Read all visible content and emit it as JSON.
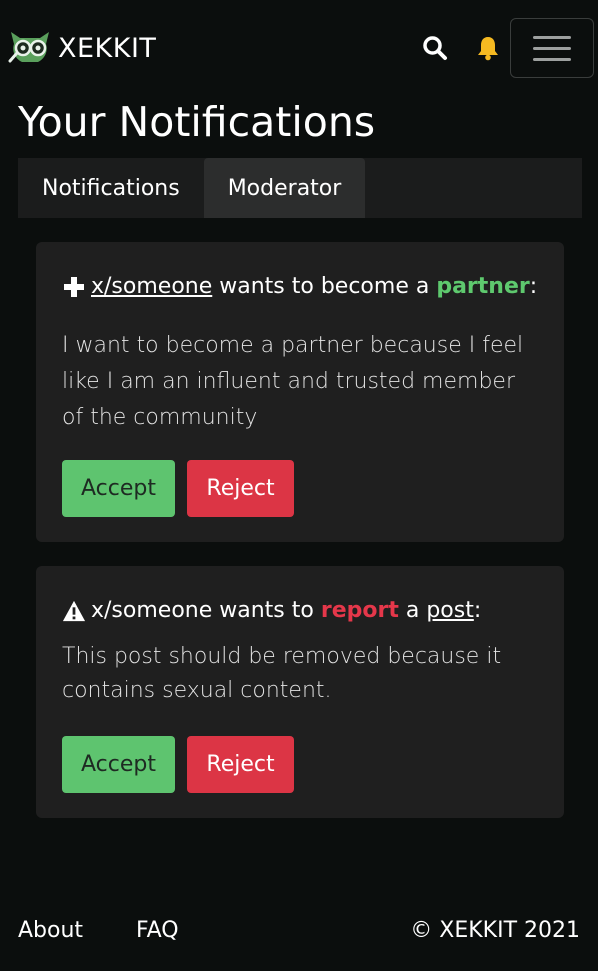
{
  "brand": {
    "name": "XEKKIT"
  },
  "page": {
    "title": "Your Notifications"
  },
  "tabs": [
    {
      "label": "Notifications",
      "active": false
    },
    {
      "label": "Moderator",
      "active": true
    }
  ],
  "requests": [
    {
      "icon": "plus-icon",
      "user": "x/someone",
      "text_middle": " wants to become a ",
      "keyword": "partner",
      "text_end": ":",
      "message": "I want to become a partner because I feel like I am an influent and trusted member of the community",
      "accept_label": "Accept",
      "reject_label": "Reject"
    },
    {
      "icon": "warning-icon",
      "user": "x/someone",
      "text_middle": " wants to ",
      "keyword": "report",
      "text_middle2": " a ",
      "target": "post",
      "text_end": ":",
      "message": "This post should be removed because it contains sexual content.",
      "accept_label": "Accept",
      "reject_label": "Reject"
    }
  ],
  "footer": {
    "about": "About",
    "faq": "FAQ",
    "copyright": "© XEKKIT 2021"
  },
  "colors": {
    "background": "#0b0e0d",
    "card": "#1f1f1f",
    "accent_green": "#5ec96e",
    "accent_red": "#e5374a",
    "bell": "#f5b921"
  }
}
